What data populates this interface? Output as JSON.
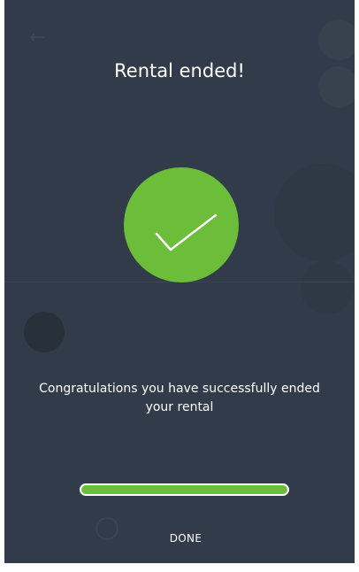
{
  "modal": {
    "title": "Rental ended!",
    "icon": "checkmark-icon",
    "message": "Congratulations you have successfully ended your rental",
    "progress_fraction": 1.0,
    "done_label": "DONE"
  },
  "colors": {
    "background": "#313b49",
    "accent_green": "#6bbd3a",
    "text": "#ffffff"
  }
}
